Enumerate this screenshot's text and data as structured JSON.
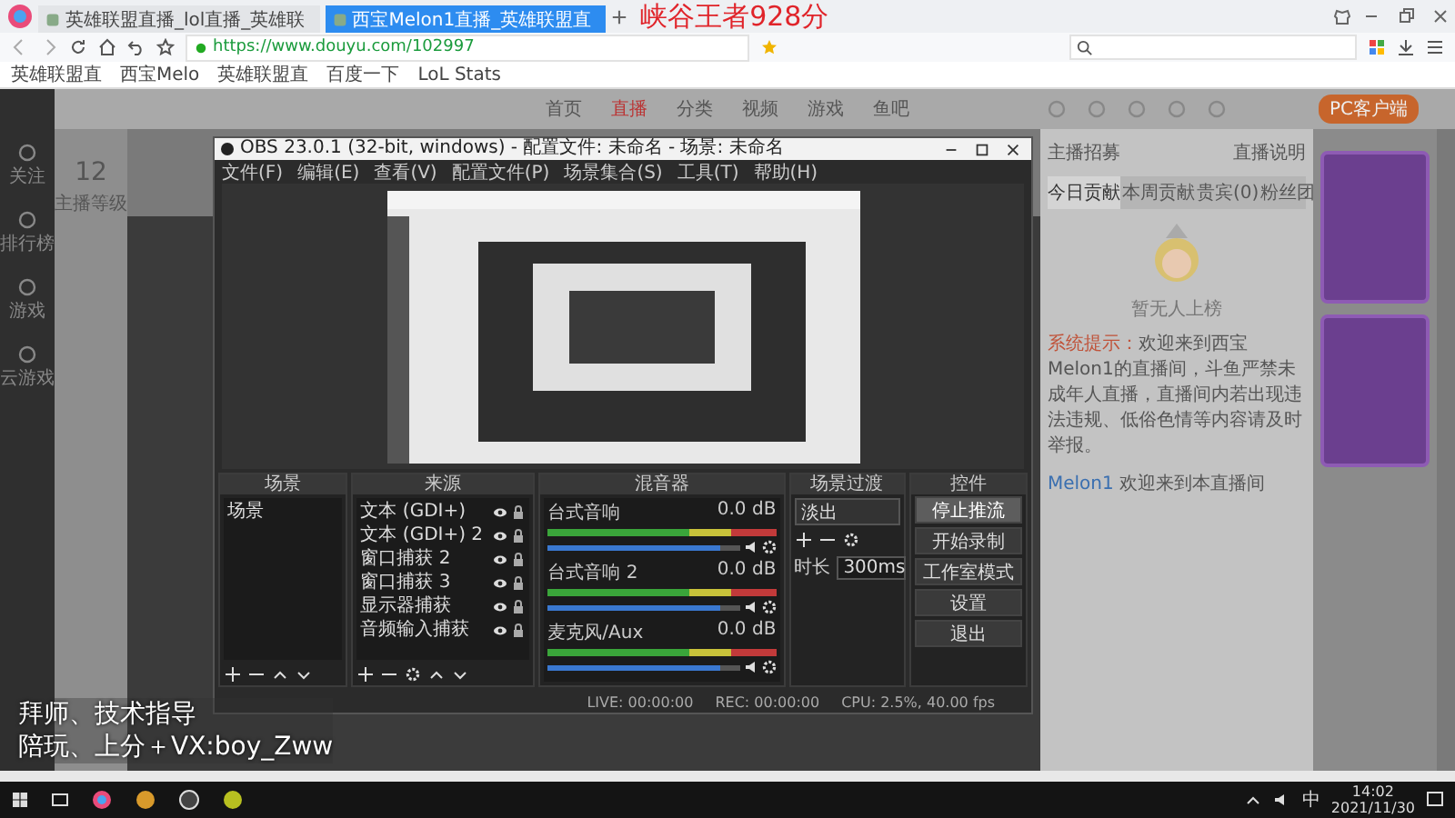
{
  "browser": {
    "tabs": [
      {
        "label": "英雄联盟直播_lol直播_英雄联",
        "selected": false
      },
      {
        "label": "西宝Melon1直播_英雄联盟直",
        "selected": true
      }
    ],
    "stream_title": "峡谷王者928分",
    "url": "https://www.douyu.com/102997",
    "bookmarks": [
      "英雄联盟直",
      "西宝Melo",
      "英雄联盟直",
      "百度一下",
      "LoL Stats"
    ]
  },
  "site": {
    "nav": [
      {
        "label": "首页",
        "selected": false
      },
      {
        "label": "直播",
        "selected": true
      },
      {
        "label": "分类",
        "selected": false
      },
      {
        "label": "视频",
        "selected": false
      },
      {
        "label": "游戏",
        "selected": false
      },
      {
        "label": "鱼吧",
        "selected": false
      }
    ],
    "pc_client_button": "PC客户端",
    "sidebar": [
      "关注",
      "排行榜",
      "游戏",
      "云游戏"
    ],
    "anchor_level": "12",
    "anchor_level_label": "主播等级",
    "chat": {
      "links": [
        "主播招募",
        "直播说明"
      ],
      "tabs": [
        {
          "label": "今日贡献",
          "selected": true
        },
        {
          "label": "本周贡献",
          "selected": false
        },
        {
          "label": "贵宾(0)",
          "selected": false
        },
        {
          "label": "粉丝团",
          "selected": false
        }
      ],
      "empty_text": "暂无人上榜",
      "notice_label": "系统提示：",
      "notice_text": "欢迎来到西宝Melon1的直播间，斗鱼严禁未成年人直播，直播间内若出现违法违规、低俗色情等内容请及时举报。",
      "welcome_user": "Melon1",
      "welcome_text": "欢迎来到本直播间"
    }
  },
  "obs": {
    "title": "OBS 23.0.1 (32-bit, windows) - 配置文件: 未命名 - 场景: 未命名",
    "menu": [
      "文件(F)",
      "编辑(E)",
      "查看(V)",
      "配置文件(P)",
      "场景集合(S)",
      "工具(T)",
      "帮助(H)"
    ],
    "docks": {
      "scenes": "场景",
      "sources": "来源",
      "mixer": "混音器",
      "transitions": "场景过渡",
      "controls": "控件"
    },
    "scenes": [
      "场景"
    ],
    "sources": [
      "文本 (GDI+)",
      "文本 (GDI+) 2",
      "窗口捕获 2",
      "窗口捕获 3",
      "显示器捕获",
      "音频输入捕获"
    ],
    "mixer": [
      {
        "name": "台式音响",
        "reading": "0.0 dB",
        "level": 0.9
      },
      {
        "name": "台式音响 2",
        "reading": "0.0 dB",
        "level": 0.9
      },
      {
        "name": "麦克风/Aux",
        "reading": "0.0 dB",
        "level": 0.9
      }
    ],
    "transition": {
      "value": "淡出",
      "duration_label": "时长",
      "duration": "300ms"
    },
    "controls": [
      {
        "label": "停止推流",
        "highlighted": true
      },
      {
        "label": "开始录制",
        "highlighted": false
      },
      {
        "label": "工作室模式",
        "highlighted": false
      },
      {
        "label": "设置",
        "highlighted": false
      },
      {
        "label": "退出",
        "highlighted": false
      }
    ],
    "status": [
      "LIVE: 00:00:00",
      "REC: 00:00:00",
      "CPU: 2.5%, 40.00 fps"
    ]
  },
  "overlay_text": [
    "拜师、技术指导",
    "陪玩、上分＋VX:boy_Zww"
  ],
  "taskbar": {
    "ime": "中",
    "time": "14:02",
    "date": "2021/11/30"
  }
}
